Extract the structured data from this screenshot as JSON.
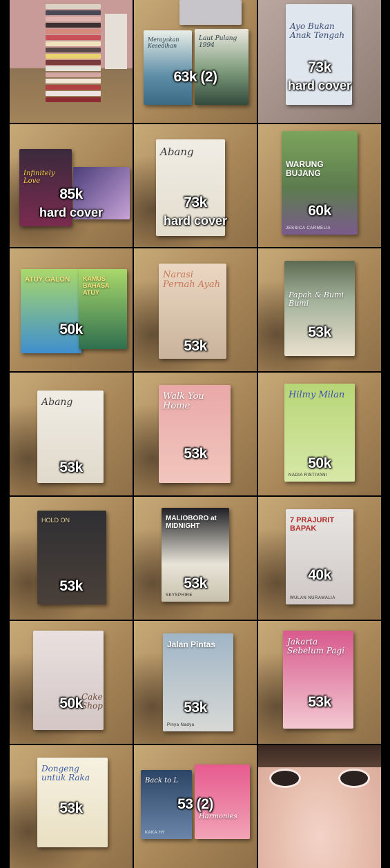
{
  "tiles": [
    {
      "name": "book-stack-photo",
      "price": "",
      "sub": ""
    },
    {
      "name": "two-books-merayakan-laut",
      "price": "63k (2)",
      "sub": ""
    },
    {
      "name": "book-ayo-bukan-anak-tengah",
      "price": "73k",
      "sub": "hard cover"
    },
    {
      "name": "book-infinitely-love",
      "price": "85k",
      "sub": "hard cover"
    },
    {
      "name": "book-abang-hardcover",
      "price": "73k",
      "sub": "hard cover"
    },
    {
      "name": "book-warung-bujang",
      "price": "60k",
      "sub": ""
    },
    {
      "name": "books-atuy-galon-kamus",
      "price": "50k",
      "sub": ""
    },
    {
      "name": "book-narasi-pernah-ayah",
      "price": "53k",
      "sub": ""
    },
    {
      "name": "book-papah-bumi",
      "price": "53k",
      "sub": ""
    },
    {
      "name": "book-abang",
      "price": "53k",
      "sub": ""
    },
    {
      "name": "book-walk-you-home",
      "price": "53k",
      "sub": ""
    },
    {
      "name": "book-hilmy-milan",
      "price": "50k",
      "sub": ""
    },
    {
      "name": "book-hold-on",
      "price": "53k",
      "sub": ""
    },
    {
      "name": "book-malioboro-midnight",
      "price": "53k",
      "sub": ""
    },
    {
      "name": "book-7-prajurit-bapak",
      "price": "40k",
      "sub": ""
    },
    {
      "name": "book-cake-shop",
      "price": "50k",
      "sub": ""
    },
    {
      "name": "book-jalan-pintas",
      "price": "53k",
      "sub": ""
    },
    {
      "name": "book-jakarta-sebelum-pagi",
      "price": "53k",
      "sub": ""
    },
    {
      "name": "book-dongeng-untuk-raka",
      "price": "53k",
      "sub": ""
    },
    {
      "name": "books-back-to-harmonies",
      "price": "53 (2)",
      "sub": ""
    },
    {
      "name": "face-photo",
      "price": "",
      "sub": ""
    }
  ],
  "covers": {
    "t2a": "Merayakan Kesedihan",
    "t2b": "Laut Pulang 1994",
    "t3": "Ayo Bukan Anak Tengah",
    "t4": "Infinitely Love",
    "t5": "Abang",
    "t6": "WARUNG BUJANG",
    "t6a": "JESSICA CARMELIA",
    "t7a": "ATUY GALON",
    "t7b": "KAMUS BAHASA ATUY",
    "t8": "Narasi Pernah Ayah",
    "t9": "Papah & Bumi Bumi",
    "t10": "Abang",
    "t11": "Walk You Home",
    "t12": "Hilmy Milan",
    "t12a": "NADIA RISTIVANI",
    "t13": "HOLD ON",
    "t14": "MALIOBORO at MIDNIGHT",
    "t14a": "SKYSPHIRE",
    "t15": "7 PRAJURIT BAPAK",
    "t15a": "WULAN NURAMALIA",
    "t16": "Cake Shop",
    "t17": "Jalan Pintas",
    "t17a": "Pinya Nadya",
    "t18": "Jakarta Sebelum Pagi",
    "t19": "Dongeng untuk Raka",
    "t20a": "Back to L",
    "t20b": "Harmonies",
    "t20c": "KAKA HY"
  }
}
